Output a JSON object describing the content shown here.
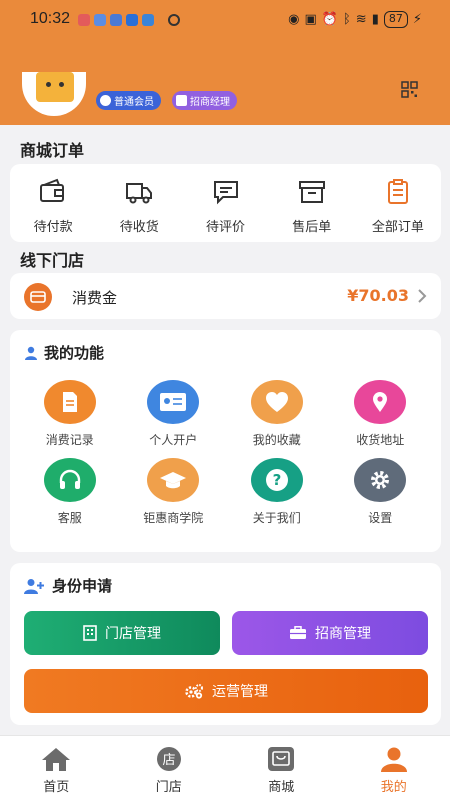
{
  "status_bar": {
    "time": "10:32",
    "battery": "87"
  },
  "profile": {
    "badge_member": "普通会员",
    "badge_manager": "招商经理"
  },
  "orders": {
    "title": "商城订单",
    "items": [
      {
        "label": "待付款",
        "icon": "wallet-icon"
      },
      {
        "label": "待收货",
        "icon": "truck-icon"
      },
      {
        "label": "待评价",
        "icon": "comment-icon"
      },
      {
        "label": "售后单",
        "icon": "box-icon"
      },
      {
        "label": "全部订单",
        "icon": "clipboard-icon"
      }
    ]
  },
  "store": {
    "title": "线下门店",
    "label": "消费金",
    "amount": "¥70.03"
  },
  "functions": {
    "title": "我的功能",
    "items": [
      {
        "label": "消费记录",
        "icon": "document-icon",
        "color": "#f0892e"
      },
      {
        "label": "个人开户",
        "icon": "id-card-icon",
        "color": "#3f86e0"
      },
      {
        "label": "我的收藏",
        "icon": "heart-icon",
        "color": "#f0a04b"
      },
      {
        "label": "收货地址",
        "icon": "location-pin-icon",
        "color": "#e8479a"
      },
      {
        "label": "客服",
        "icon": "headset-icon",
        "color": "#1fad6b"
      },
      {
        "label": "钜惠商学院",
        "icon": "graduation-cap-icon",
        "color": "#f0a04b"
      },
      {
        "label": "关于我们",
        "icon": "question-icon",
        "color": "#16a085"
      },
      {
        "label": "设置",
        "icon": "gear-icon",
        "color": "#5f6b7a"
      }
    ]
  },
  "identity": {
    "title": "身份申请",
    "store_button": "门店管理",
    "merchant_button": "招商管理",
    "ops_button": "运营管理"
  },
  "tabbar": {
    "items": [
      {
        "label": "首页",
        "icon": "home-icon"
      },
      {
        "label": "门店",
        "icon": "store-icon"
      },
      {
        "label": "商城",
        "icon": "shop-bag-icon"
      },
      {
        "label": "我的",
        "icon": "user-icon",
        "active": true
      }
    ]
  },
  "colors": {
    "header": "#ea8a3b",
    "accent": "#e9742b"
  }
}
